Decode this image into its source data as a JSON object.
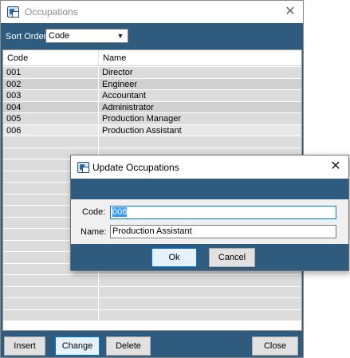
{
  "main_window": {
    "title": "Occupations",
    "close_glyph": "✕",
    "sort_order_label": "Sort Order",
    "sort_order_value": "Code",
    "columns": [
      "Code",
      "Name"
    ],
    "rows": [
      {
        "code": "001",
        "name": "Director"
      },
      {
        "code": "002",
        "name": "Engineer"
      },
      {
        "code": "003",
        "name": "Accountant"
      },
      {
        "code": "004",
        "name": "Administrator"
      },
      {
        "code": "005",
        "name": "Production Manager"
      },
      {
        "code": "006",
        "name": "Production Assistant"
      }
    ],
    "buttons": {
      "insert": "Insert",
      "change": "Change",
      "delete": "Delete",
      "close": "Close"
    }
  },
  "dialog": {
    "title": "Update Occupations",
    "close_glyph": "✕",
    "code_label": "Code:",
    "code_value": "006",
    "name_label": "Name:",
    "name_value": "Production Assistant",
    "ok": "Ok",
    "cancel": "Cancel"
  },
  "colors": {
    "panel": "#2f5b7f",
    "grid_row": "#dcdcdc",
    "selection": "#3399ff"
  },
  "icons": {
    "app": "app-window-icon",
    "dropdown": "chevron-down-icon",
    "close": "close-icon"
  }
}
